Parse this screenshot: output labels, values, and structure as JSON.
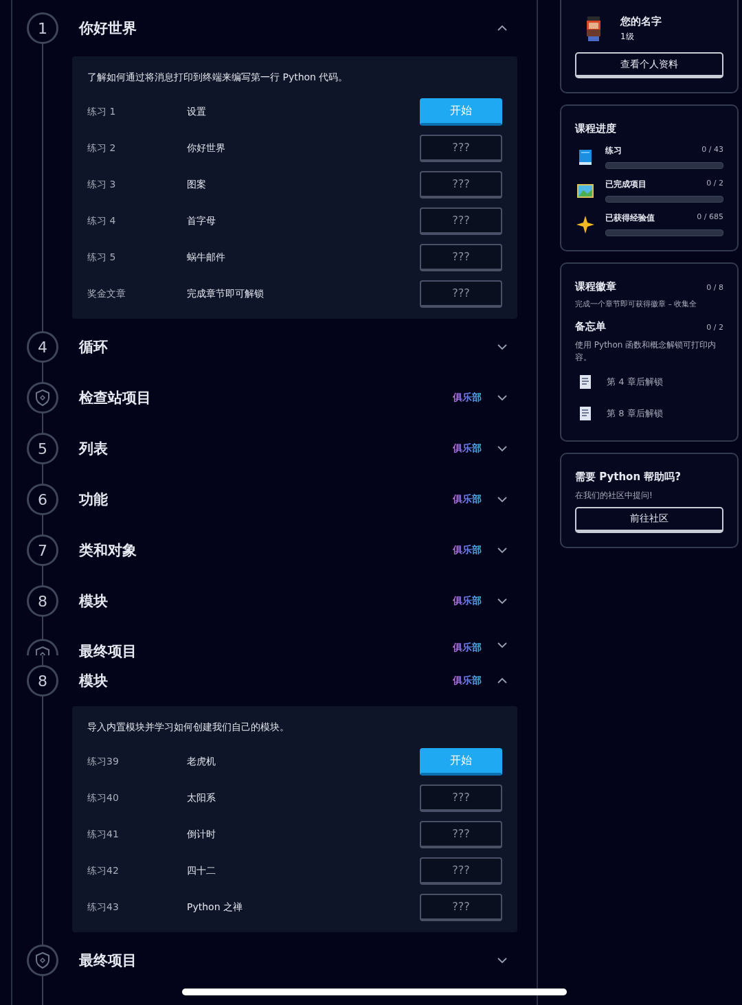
{
  "chapters": [
    {
      "kind": "number",
      "marker": "1",
      "title": "你好世界",
      "club": false,
      "expanded": true,
      "description": "了解如何通过将消息打印到终端来编写第一行 Python 代码。",
      "exercises": [
        {
          "label": "练习 1",
          "name": "设置",
          "button": "开始",
          "unlocked": true
        },
        {
          "label": "练习 2",
          "name": "你好世界",
          "button": "???",
          "unlocked": false
        },
        {
          "label": "练习 3",
          "name": "图案",
          "button": "???",
          "unlocked": false
        },
        {
          "label": "练习 4",
          "name": "首字母",
          "button": "???",
          "unlocked": false
        },
        {
          "label": "练习 5",
          "name": "蜗牛邮件",
          "button": "???",
          "unlocked": false
        },
        {
          "label": "奖金文章",
          "name": "完成章节即可解锁",
          "button": "???",
          "unlocked": false
        }
      ]
    },
    {
      "kind": "number",
      "marker": "4",
      "title": "循环",
      "club": false,
      "expanded": false
    },
    {
      "kind": "project",
      "title": "检查站项目",
      "club": true,
      "club_label": "俱乐部",
      "expanded": false
    },
    {
      "kind": "number",
      "marker": "5",
      "title": "列表",
      "club": true,
      "club_label": "俱乐部",
      "expanded": false
    },
    {
      "kind": "number",
      "marker": "6",
      "title": "功能",
      "club": true,
      "club_label": "俱乐部",
      "expanded": false
    },
    {
      "kind": "number",
      "marker": "7",
      "title": "类和对象",
      "club": true,
      "club_label": "俱乐部",
      "expanded": false
    },
    {
      "kind": "number",
      "marker": "8",
      "title": "模块",
      "club": true,
      "club_label": "俱乐部",
      "expanded": false
    },
    {
      "kind": "project",
      "title": "最终项目",
      "club": true,
      "club_label": "俱乐部",
      "expanded": false,
      "clipped": true
    },
    {
      "kind": "number",
      "marker": "8",
      "title": "模块",
      "club": true,
      "club_label": "俱乐部",
      "expanded": true,
      "description": "导入内置模块并学习如何创建我们自己的模块。",
      "exercises": [
        {
          "label": "练习39",
          "name": "老虎机",
          "button": "开始",
          "unlocked": true
        },
        {
          "label": "练习40",
          "name": "太阳系",
          "button": "???",
          "unlocked": false
        },
        {
          "label": "练习41",
          "name": "倒计时",
          "button": "???",
          "unlocked": false
        },
        {
          "label": "练习42",
          "name": "四十二",
          "button": "???",
          "unlocked": false
        },
        {
          "label": "练习43",
          "name": "Python 之禅",
          "button": "???",
          "unlocked": false
        }
      ]
    },
    {
      "kind": "project",
      "title": "最终项目",
      "club": false,
      "expanded": false
    }
  ],
  "profile": {
    "name": "您的名字",
    "level": "1级",
    "button": "查看个人资料"
  },
  "progress": {
    "title": "课程进度",
    "items": [
      {
        "kind": "book",
        "label": "练习",
        "count": "0 / 43",
        "level": 0
      },
      {
        "kind": "picture",
        "label": "已完成项目",
        "count": "0 / 2",
        "level": 0
      },
      {
        "kind": "star",
        "label": "已获得经验值",
        "count": "0 / 685",
        "level": 0
      }
    ]
  },
  "badges": {
    "title": "课程徽章",
    "count": "0 / 8",
    "description": "完成一个章节即可获得徽章 – 收集全"
  },
  "memos": {
    "title": "备忘单",
    "count": "0 / 2",
    "description": "使用 Python 函数和概念解锁可打印内容。",
    "items": [
      {
        "text": "第 4 章后解锁"
      },
      {
        "text": "第 8 章后解锁"
      }
    ]
  },
  "help": {
    "title": "需要 Python 帮助吗?",
    "text": "在我们的社区中提问!",
    "button": "前往社区"
  }
}
